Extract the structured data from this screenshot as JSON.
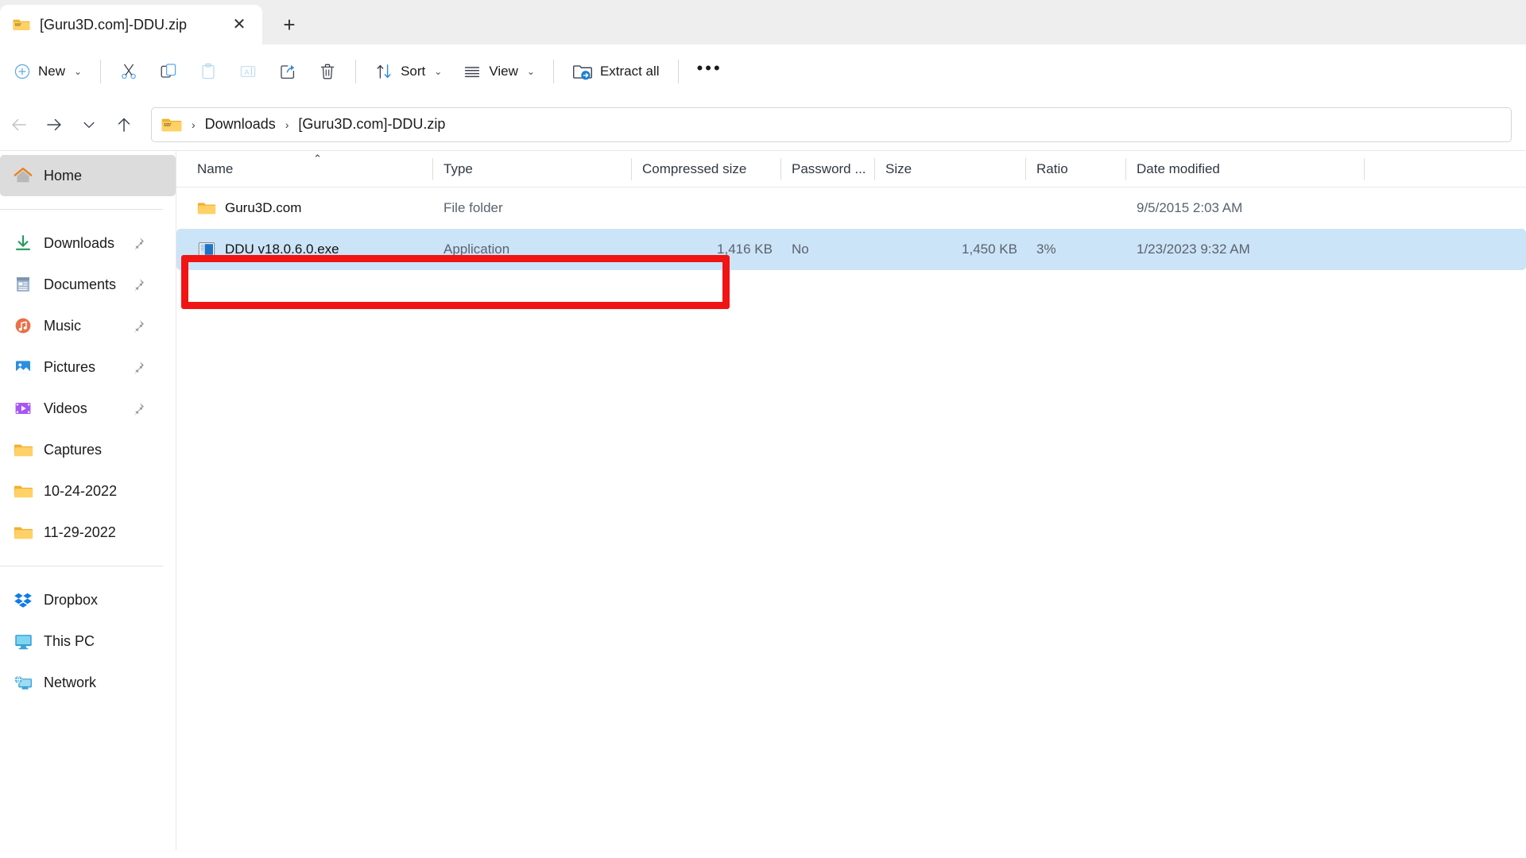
{
  "window": {
    "tab": {
      "title": "[Guru3D.com]-DDU.zip",
      "icon": "zip-folder-icon",
      "close_label": "✕",
      "new_tab_label": "+"
    }
  },
  "toolbar": {
    "new_label": "New",
    "new_icon": "plus-circle-icon",
    "cut_icon": "scissors-icon",
    "copy_icon": "copy-icon",
    "paste_icon": "paste-icon",
    "rename_icon": "rename-icon",
    "share_icon": "share-icon",
    "delete_icon": "trash-icon",
    "sort_label": "Sort",
    "sort_icon": "sort-arrows-icon",
    "view_label": "View",
    "view_icon": "view-lines-icon",
    "extract_all_label": "Extract all",
    "extract_all_icon": "extract-folder-icon",
    "more_label": "•••",
    "chevron": "⌄"
  },
  "addressbar": {
    "back_icon": "arrow-left-icon",
    "forward_icon": "arrow-right-icon",
    "recent_icon": "chevron-down-icon",
    "up_icon": "arrow-up-icon",
    "folder_icon": "zip-folder-icon",
    "separator": "›",
    "crumbs": [
      "Downloads",
      "[Guru3D.com]-DDU.zip"
    ]
  },
  "sidebar": {
    "home": {
      "label": "Home",
      "icon": "home-icon"
    },
    "quick_access": [
      {
        "label": "Downloads",
        "icon": "downloads-icon",
        "pinned": true
      },
      {
        "label": "Documents",
        "icon": "documents-icon",
        "pinned": true
      },
      {
        "label": "Music",
        "icon": "music-icon",
        "pinned": true
      },
      {
        "label": "Pictures",
        "icon": "pictures-icon",
        "pinned": true
      },
      {
        "label": "Videos",
        "icon": "videos-icon",
        "pinned": true
      },
      {
        "label": "Captures",
        "icon": "folder-icon",
        "pinned": false
      },
      {
        "label": "10-24-2022",
        "icon": "folder-icon",
        "pinned": false
      },
      {
        "label": "11-29-2022",
        "icon": "folder-icon",
        "pinned": false
      }
    ],
    "drives": [
      {
        "label": "Dropbox",
        "icon": "dropbox-icon"
      },
      {
        "label": "This PC",
        "icon": "this-pc-icon"
      },
      {
        "label": "Network",
        "icon": "network-icon"
      }
    ]
  },
  "filelist": {
    "columns": [
      {
        "key": "name",
        "label": "Name",
        "sorted": true,
        "sort_caret": "⌃"
      },
      {
        "key": "type",
        "label": "Type"
      },
      {
        "key": "compressed_size",
        "label": "Compressed size"
      },
      {
        "key": "password",
        "label": "Password ..."
      },
      {
        "key": "size",
        "label": "Size"
      },
      {
        "key": "ratio",
        "label": "Ratio"
      },
      {
        "key": "date_modified",
        "label": "Date modified"
      }
    ],
    "rows": [
      {
        "name": "Guru3D.com",
        "icon": "folder-icon",
        "type": "File folder",
        "compressed_size": "",
        "password": "",
        "size": "",
        "ratio": "",
        "date_modified": "9/5/2015 2:03 AM",
        "selected": false,
        "highlighted": false
      },
      {
        "name": "DDU v18.0.6.0.exe",
        "icon": "application-exe-icon",
        "type": "Application",
        "compressed_size": "1,416 KB",
        "password": "No",
        "size": "1,450 KB",
        "ratio": "3%",
        "date_modified": "1/23/2023 9:32 AM",
        "selected": true,
        "highlighted": true
      }
    ]
  },
  "annotation": {
    "highlight_color": "#f01414",
    "target": "DDU v18.0.6.0.exe"
  }
}
